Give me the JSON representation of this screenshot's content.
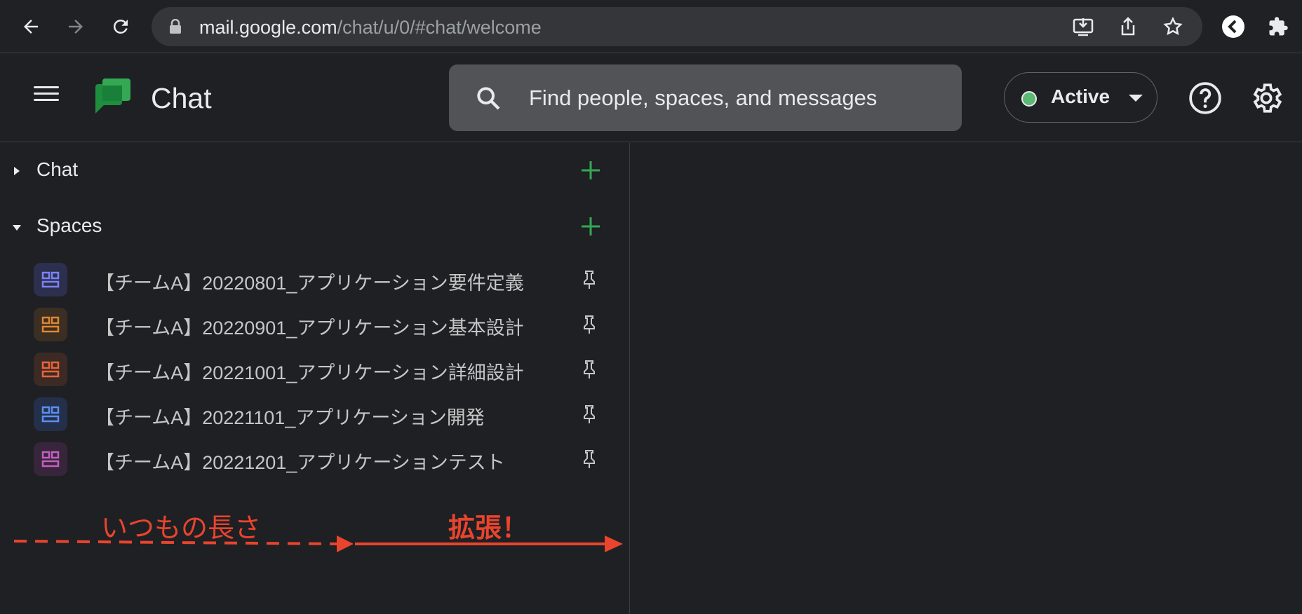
{
  "browser": {
    "url_host": "mail.google.com",
    "url_path": "/chat/u/0/#chat/welcome",
    "icons": [
      "back-icon",
      "forward-icon",
      "reload-icon",
      "lock-icon",
      "install-icon",
      "share-icon",
      "star-icon",
      "extension-chevron-icon",
      "puzzle-icon"
    ]
  },
  "header": {
    "title": "Chat",
    "search_placeholder": "Find people, spaces, and messages",
    "status": "Active",
    "status_color": "#5bb974",
    "icons": [
      "menu-icon",
      "chat-logo",
      "search-icon",
      "help-icon",
      "settings-icon"
    ]
  },
  "sidebar": {
    "sections": [
      {
        "label": "Chat",
        "expanded": false
      },
      {
        "label": "Spaces",
        "expanded": true
      }
    ],
    "spaces": [
      {
        "name": "【チームA】20220801_アプリケーション要件定義",
        "color": "#7b83f4",
        "bg": "#2c2f4d"
      },
      {
        "name": "【チームA】20220901_アプリケーション基本設計",
        "color": "#e0872e",
        "bg": "#3b2e22"
      },
      {
        "name": "【チームA】20221001_アプリケーション詳細設計",
        "color": "#e8643a",
        "bg": "#3c2a24"
      },
      {
        "name": "【チームA】20221101_アプリケーション開発",
        "color": "#5b8ef0",
        "bg": "#24304a"
      },
      {
        "name": "【チームA】20221201_アプリケーションテスト",
        "color": "#c45fc0",
        "bg": "#37263b"
      }
    ],
    "accent_plus": "#34a853"
  },
  "annotations": {
    "usual_label": "いつもの長さ",
    "expand_label": "拡張！",
    "color": "#e9442e"
  }
}
